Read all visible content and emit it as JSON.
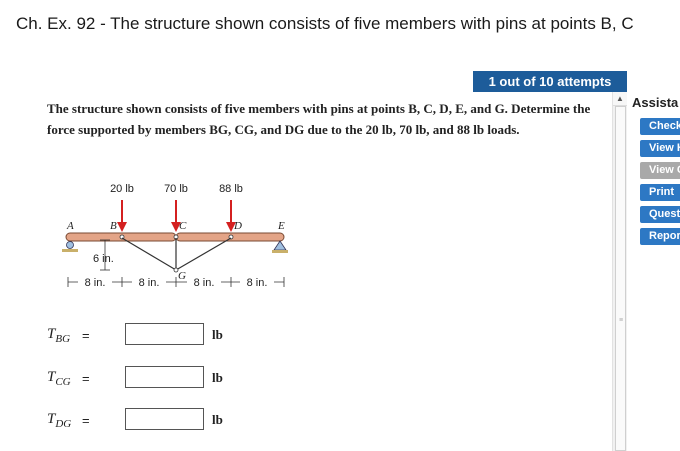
{
  "header": {
    "title": "Ch. Ex. 92 - The structure shown consists of five members with pins at points B, C"
  },
  "attempts": "1 out of 10 attempts",
  "problem": {
    "text": "The structure shown consists of five members with pins at points B, C, D, E, and G. Determine the force supported by members BG, CG, and DG due to the 20 lb, 70 lb, and 88 lb loads."
  },
  "assistance": {
    "title": "Assista",
    "buttons": [
      {
        "label": "Check",
        "enabled": true
      },
      {
        "label": "View H",
        "enabled": true
      },
      {
        "label": "View C",
        "enabled": false
      },
      {
        "label": "Print",
        "enabled": true
      },
      {
        "label": "Quest",
        "enabled": true
      },
      {
        "label": "Repor",
        "enabled": true
      }
    ]
  },
  "diagram": {
    "loads": [
      {
        "label": "20 lb",
        "at": "B"
      },
      {
        "label": "70 lb",
        "at": "C"
      },
      {
        "label": "88 lb",
        "at": "D"
      }
    ],
    "points": {
      "A": "A",
      "B": "B",
      "C": "C",
      "D": "D",
      "E": "E",
      "G": "G"
    },
    "height_dim": "6 in.",
    "spans": [
      "8 in.",
      "8 in.",
      "8 in.",
      "8 in."
    ]
  },
  "answers": [
    {
      "symbol": "T",
      "sub": "BG",
      "eq": "=",
      "value": "",
      "unit": "lb"
    },
    {
      "symbol": "T",
      "sub": "CG",
      "eq": "=",
      "value": "",
      "unit": "lb"
    },
    {
      "symbol": "T",
      "sub": "DG",
      "eq": "=",
      "value": "",
      "unit": "lb"
    }
  ],
  "colors": {
    "badge": "#1d5c9a",
    "button": "#2d78c4",
    "button_disabled": "#a9a9a9",
    "beam": "#e3a487",
    "arrow": "#d42020"
  }
}
